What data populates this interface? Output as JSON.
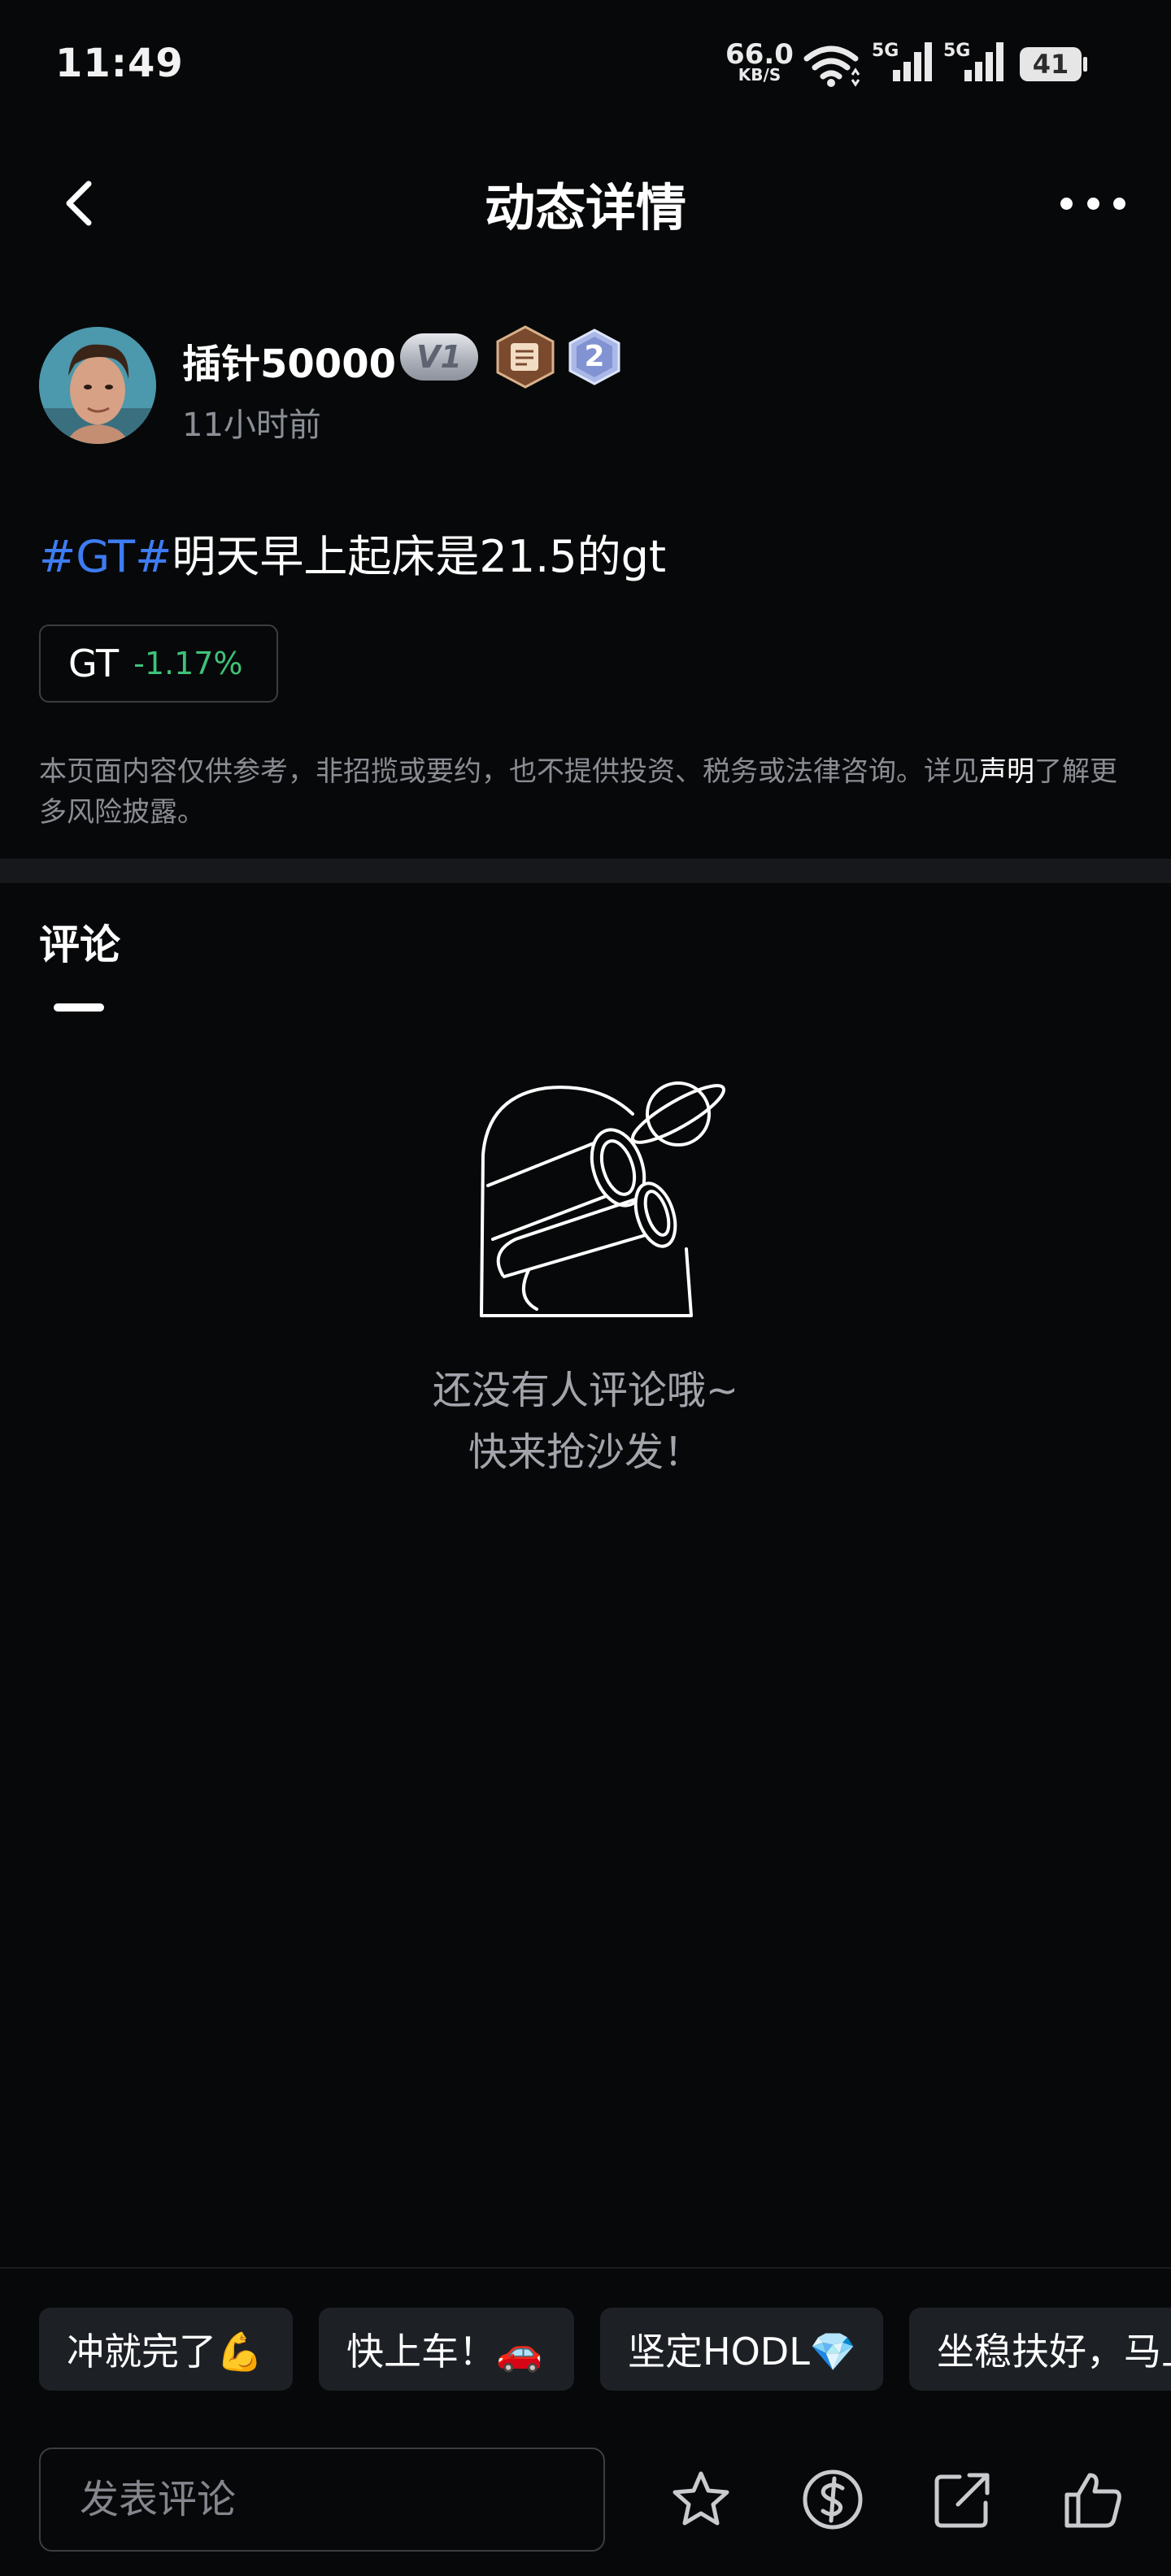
{
  "status_bar": {
    "time": "11:49",
    "net_speed_value": "66.0",
    "net_speed_unit": "KB/S",
    "signal_1_label": "5G",
    "signal_2_label": "5G",
    "battery": "41"
  },
  "nav": {
    "title": "动态详情"
  },
  "author": {
    "name": "插针50000",
    "vip_badge": "V1",
    "level_badge": "2",
    "posted_time": "11小时前"
  },
  "post": {
    "hashtag": "#GT#",
    "text": "明天早上起床是21.5的gt",
    "ticker": {
      "symbol": "GT",
      "change": "-1.17%",
      "change_color": "#3fc27a"
    },
    "disclaimer": "本页面内容仅供参考，非招揽或要约，也不提供投资、税务或法律咨询。详见",
    "disclaimer_link": "声明",
    "disclaimer_tail": "了解更多风险披露。"
  },
  "comments": {
    "tab_label": "评论",
    "empty_line1": "还没有人评论哦~",
    "empty_line2": "快来抢沙发！"
  },
  "quick_replies": [
    "冲就完了💪",
    "快上车！🚗",
    "坚定HODL💎",
    "坐稳扶好，马上"
  ],
  "bottom_bar": {
    "comment_placeholder": "发表评论",
    "icons": [
      "star-icon",
      "tip-coin-icon",
      "share-icon",
      "like-icon"
    ]
  },
  "colors": {
    "background": "#070809",
    "hashtag": "#3d7cf2",
    "chip_background": "#1d2126"
  }
}
